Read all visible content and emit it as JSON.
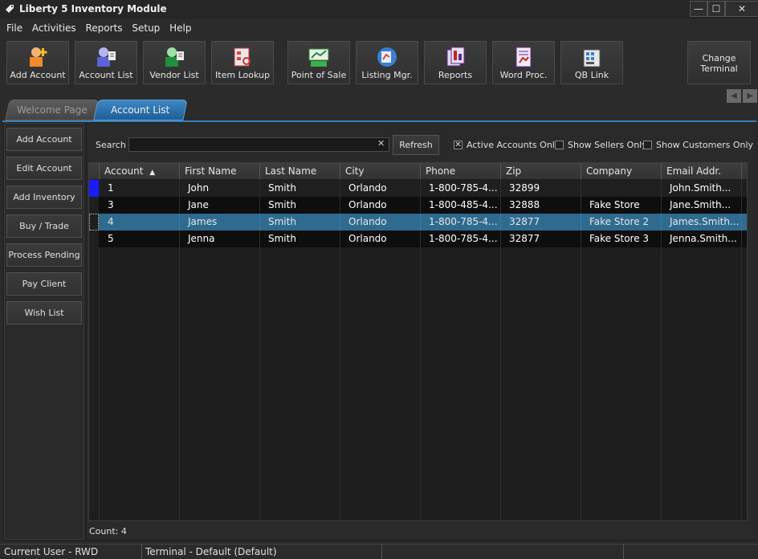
{
  "window": {
    "title": "Liberty 5 Inventory Module",
    "minimize": "—",
    "maximize": "☐",
    "close": "✕"
  },
  "menu": [
    "File",
    "Activities",
    "Reports",
    "Setup",
    "Help"
  ],
  "toolbar": [
    {
      "label": "Add Account",
      "icon": "add-account-icon"
    },
    {
      "label": "Account List",
      "icon": "account-list-icon"
    },
    {
      "label": "Vendor List",
      "icon": "vendor-list-icon"
    },
    {
      "label": "Item Lookup",
      "icon": "item-lookup-icon"
    },
    {
      "label": "Point of Sale",
      "icon": "point-of-sale-icon"
    },
    {
      "label": "Listing Mgr.",
      "icon": "listing-manager-icon"
    },
    {
      "label": "Reports",
      "icon": "reports-icon"
    },
    {
      "label": "Word Proc.",
      "icon": "word-processor-icon"
    },
    {
      "label": "QB Link",
      "icon": "qb-link-icon"
    }
  ],
  "change_terminal": {
    "line1": "Change",
    "line2": "Terminal"
  },
  "tabs": [
    {
      "label": "Welcome Page",
      "active": false
    },
    {
      "label": "Account List",
      "active": true
    }
  ],
  "side_actions": [
    "Add Account",
    "Edit Account",
    "Add Inventory",
    "Buy / Trade",
    "Process Pending",
    "Pay Client",
    "Wish List"
  ],
  "search": {
    "label": "Search",
    "value": "",
    "clear": "✕",
    "refresh": "Refresh"
  },
  "filters": [
    {
      "label": "Active Accounts Only",
      "checked": true,
      "mark": "✕"
    },
    {
      "label": "Show Sellers Only",
      "checked": false,
      "mark": ""
    },
    {
      "label": "Show Customers Only",
      "checked": false,
      "mark": ""
    }
  ],
  "grid": {
    "columns": [
      "Account",
      "First Name",
      "Last Name",
      "City",
      "Phone",
      "Zip",
      "Company",
      "Email Addr."
    ],
    "sort_indicator": "▲",
    "rows": [
      {
        "cells": [
          "1",
          "John",
          "Smith",
          "Orlando",
          "1-800-785-4...",
          "32899",
          "",
          "John.Smith..."
        ],
        "selected": false,
        "marker": "current"
      },
      {
        "cells": [
          "3",
          "Jane",
          "Smith",
          "Orlando",
          "1-800-485-4...",
          "32888",
          "Fake Store",
          "Jane.Smith..."
        ],
        "selected": false,
        "marker": ""
      },
      {
        "cells": [
          "4",
          "James",
          "Smith",
          "Orlando",
          "1-800-785-4...",
          "32877",
          "Fake Store 2",
          "James.Smith..."
        ],
        "selected": true,
        "marker": "focus"
      },
      {
        "cells": [
          "5",
          "Jenna",
          "Smith",
          "Orlando",
          "1-800-785-4...",
          "32877",
          "Fake Store 3",
          "Jenna.Smith..."
        ],
        "selected": false,
        "marker": ""
      }
    ]
  },
  "count_label": "Count: 4",
  "status": {
    "user": "Current User - RWD",
    "terminal": "Terminal - Default (Default)"
  },
  "colors": {
    "accent": "#2f6b8f",
    "tab_active": "#2a72b0",
    "row_marker": "#1a1aff"
  }
}
